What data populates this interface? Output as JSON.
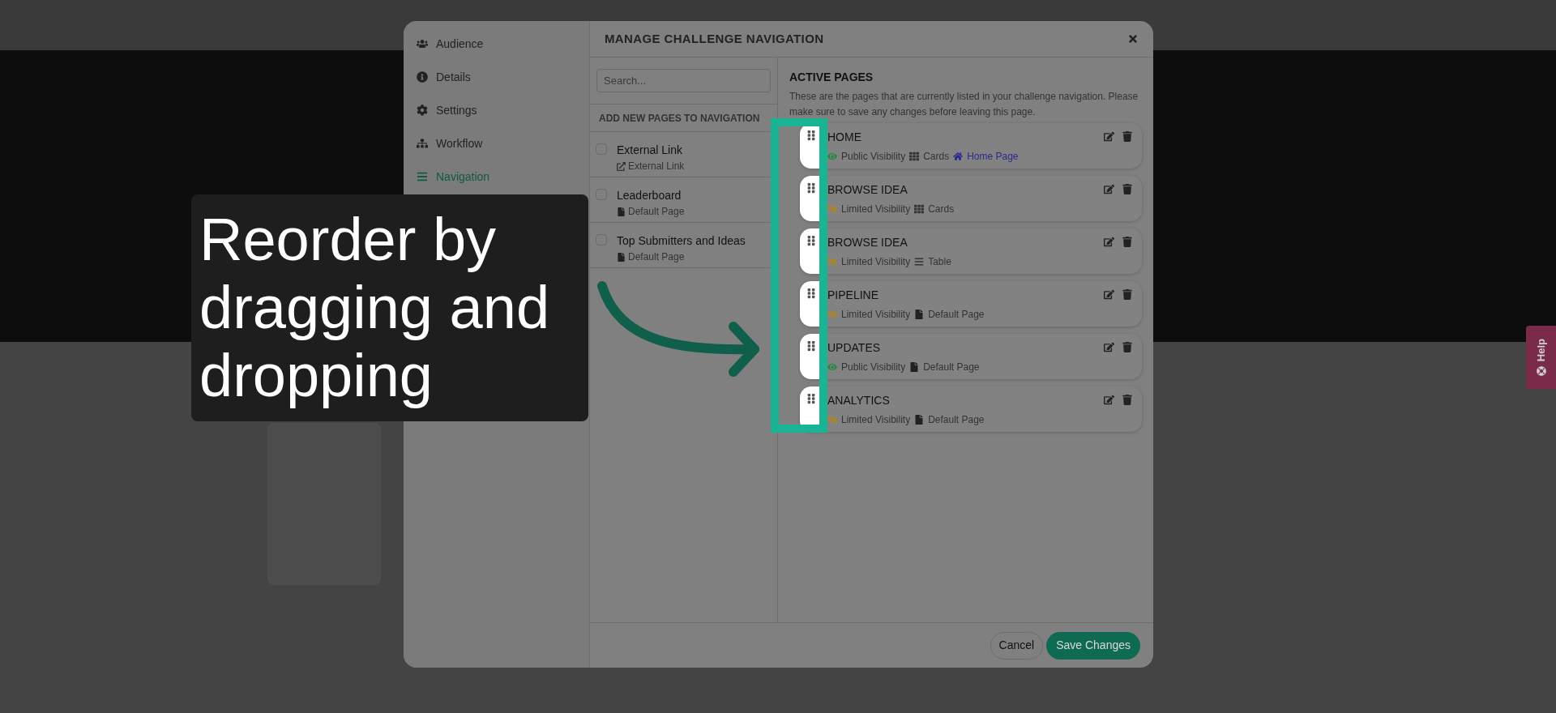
{
  "sidebar": {
    "items": [
      {
        "label": "Audience",
        "kind": "users",
        "selected": false
      },
      {
        "label": "Details",
        "kind": "info",
        "selected": false
      },
      {
        "label": "Settings",
        "kind": "gear",
        "selected": false
      },
      {
        "label": "Workflow",
        "kind": "workflow",
        "selected": false
      },
      {
        "label": "Navigation",
        "kind": "bars",
        "selected": true
      }
    ]
  },
  "modal": {
    "title": "MANAGE CHALLENGE NAVIGATION"
  },
  "search": {
    "placeholder": "Search..."
  },
  "add_pages": {
    "title": "ADD NEW PAGES TO NAVIGATION",
    "items": [
      {
        "title": "External Link",
        "type": {
          "kind": "external",
          "label": "External Link"
        },
        "checked": false
      },
      {
        "title": "Leaderboard",
        "type": {
          "kind": "default",
          "label": "Default Page"
        },
        "checked": false
      },
      {
        "title": "Top Submitters and Ideas",
        "type": {
          "kind": "default",
          "label": "Default Page"
        },
        "checked": false
      }
    ]
  },
  "active_pages": {
    "title": "ACTIVE PAGES",
    "description": "These are the pages that are currently listed in your challenge navigation. Please make sure to save any changes before leaving this page.",
    "pages": [
      {
        "title": "HOME",
        "visibility": {
          "kind": "public",
          "label": "Public Visibility"
        },
        "layout": {
          "kind": "cards",
          "label": "Cards"
        },
        "home_label": "Home Page"
      },
      {
        "title": "BROWSE IDEA",
        "visibility": {
          "kind": "limited",
          "label": "Limited Visibility"
        },
        "layout": {
          "kind": "cards",
          "label": "Cards"
        }
      },
      {
        "title": "BROWSE IDEA",
        "visibility": {
          "kind": "limited",
          "label": "Limited Visibility"
        },
        "layout": {
          "kind": "table",
          "label": "Table"
        }
      },
      {
        "title": "PIPELINE",
        "visibility": {
          "kind": "limited",
          "label": "Limited Visibility"
        },
        "layout": {
          "kind": "default",
          "label": "Default Page"
        }
      },
      {
        "title": "UPDATES",
        "visibility": {
          "kind": "public",
          "label": "Public Visibility"
        },
        "layout": {
          "kind": "default",
          "label": "Default Page"
        }
      },
      {
        "title": "ANALYTICS",
        "visibility": {
          "kind": "limited",
          "label": "Limited Visibility"
        },
        "layout": {
          "kind": "default",
          "label": "Default Page"
        }
      }
    ]
  },
  "footer": {
    "buttons": [
      {
        "label": "Cancel",
        "kind": "secondary"
      },
      {
        "label": "Save Changes",
        "kind": "primary"
      }
    ]
  },
  "caption": "Reorder by dragging and dropping",
  "help_tab": {
    "label": "Help"
  }
}
